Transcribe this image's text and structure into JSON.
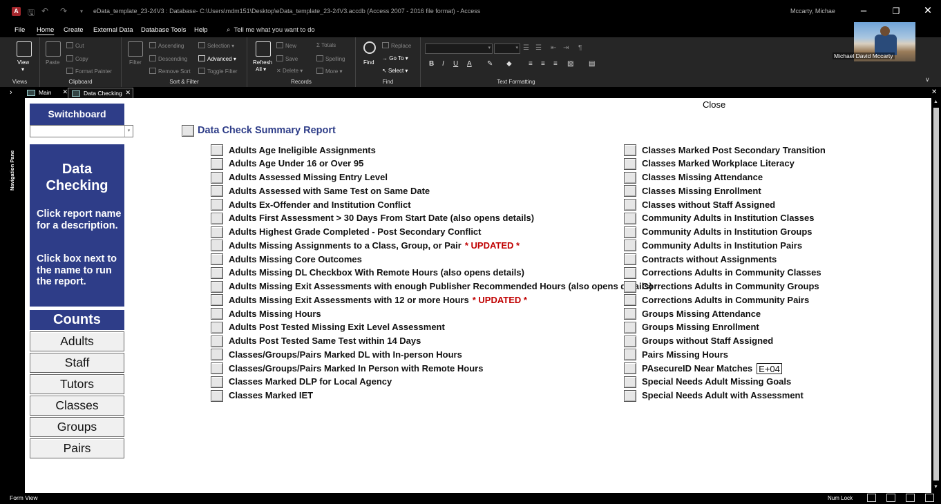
{
  "window": {
    "title": "eData_template_23-24V3 : Database- C:\\Users\\mdm151\\Desktop\\eData_template_23-24V3.accdb (Access 2007 - 2016 file format)  -  Access",
    "user_short": "Mccarty, Michae",
    "app_logo": "A"
  },
  "menu": {
    "tabs": [
      "File",
      "Home",
      "Create",
      "External Data",
      "Database Tools",
      "Help"
    ],
    "active": "Home",
    "tell_me": "Tell me what you want to do"
  },
  "ribbon": {
    "views": {
      "label": "Views",
      "view": "View"
    },
    "clipboard": {
      "label": "Clipboard",
      "paste": "Paste",
      "cut": "Cut",
      "copy": "Copy",
      "format_painter": "Format Painter"
    },
    "sort_filter": {
      "label": "Sort & Filter",
      "filter": "Filter",
      "ascending": "Ascending",
      "descending": "Descending",
      "remove_sort": "Remove Sort",
      "selection": "Selection",
      "advanced": "Advanced",
      "toggle_filter": "Toggle Filter"
    },
    "records": {
      "label": "Records",
      "refresh": "Refresh",
      "refresh_all": "All",
      "new": "New",
      "save": "Save",
      "delete": "Delete",
      "totals": "Totals",
      "spelling": "Spelling",
      "more": "More"
    },
    "find": {
      "label": "Find",
      "find": "Find",
      "replace": "Replace",
      "go_to": "Go To",
      "select": "Select"
    },
    "text_formatting": {
      "label": "Text Formatting",
      "bold": "B",
      "italic": "I",
      "underline": "U",
      "font_color": "A"
    }
  },
  "profile": {
    "name": "Michael David Mccarty"
  },
  "nav_pane": {
    "label": "Navigation Pane"
  },
  "doc_tabs": [
    {
      "label": "Main",
      "active": false
    },
    {
      "label": "Data Checking",
      "active": true
    }
  ],
  "form": {
    "close": "Close",
    "switchboard": "Switchboard",
    "switchboard_combo_value": "",
    "info": {
      "title": "Data Checking",
      "para1": "Click report name for a description.",
      "para2": "Click box next to the name to run the report."
    },
    "counts": {
      "heading": "Counts",
      "buttons": [
        "Adults",
        "Staff",
        "Tutors",
        "Classes",
        "Groups",
        "Pairs"
      ]
    },
    "report_title": "Data Check Summary Report",
    "left_reports": [
      {
        "label": "Adults Age Ineligible Assignments"
      },
      {
        "label": "Adults Age Under 16 or Over 95"
      },
      {
        "label": "Adults Assessed Missing Entry Level"
      },
      {
        "label": "Adults Assessed with Same Test on Same Date"
      },
      {
        "label": "Adults Ex-Offender and Institution Conflict"
      },
      {
        "label": "Adults First Assessment > 30 Days From Start Date (also opens details)"
      },
      {
        "label": "Adults Highest Grade Completed - Post Secondary Conflict"
      },
      {
        "label": "Adults Missing Assignments to a Class, Group, or Pair",
        "updated": "* UPDATED *"
      },
      {
        "label": "Adults Missing Core Outcomes"
      },
      {
        "label": "Adults Missing DL Checkbox With Remote Hours (also opens details)"
      },
      {
        "label": "Adults Missing Exit Assessments with enough Publisher Recommended Hours (also opens details)"
      },
      {
        "label": "Adults Missing Exit Assessments with 12 or more Hours",
        "updated": "* UPDATED *"
      },
      {
        "label": "Adults Missing Hours"
      },
      {
        "label": "Adults Post Tested Missing Exit Level Assessment"
      },
      {
        "label": "Adults Post Tested Same Test within 14 Days"
      },
      {
        "label": "Classes/Groups/Pairs Marked DL with In-person Hours"
      },
      {
        "label": "Classes/Groups/Pairs Marked In Person with Remote Hours"
      },
      {
        "label": "Classes Marked DLP for Local Agency"
      },
      {
        "label": "Classes Marked IET"
      }
    ],
    "right_reports": [
      {
        "label": "Classes Marked Post Secondary Transition"
      },
      {
        "label": "Classes Marked Workplace Literacy"
      },
      {
        "label": "Classes Missing Attendance"
      },
      {
        "label": "Classes Missing Enrollment"
      },
      {
        "label": "Classes without Staff Assigned"
      },
      {
        "label": "Community Adults in Institution Classes"
      },
      {
        "label": "Community Adults in Institution Groups"
      },
      {
        "label": "Community Adults in Institution Pairs"
      },
      {
        "label": "Contracts without Assignments"
      },
      {
        "label": "Corrections Adults in Community Classes"
      },
      {
        "label": "Corrections Adults in Community Groups"
      },
      {
        "label": "Corrections Adults in Community Pairs"
      },
      {
        "label": "Groups Missing Attendance"
      },
      {
        "label": "Groups Missing Enrollment"
      },
      {
        "label": "Groups without Staff Assigned"
      },
      {
        "label": "Pairs Missing Hours"
      },
      {
        "label": "PAsecureID Near Matches",
        "tag": "E+04"
      },
      {
        "label": "Special Needs Adult Missing Goals"
      },
      {
        "label": "Special Needs Adult with Assessment"
      }
    ]
  },
  "status": {
    "left": "Form View",
    "num_lock": "Num Lock"
  },
  "colors": {
    "accent": "#2e3d88",
    "updated": "#c00000"
  }
}
